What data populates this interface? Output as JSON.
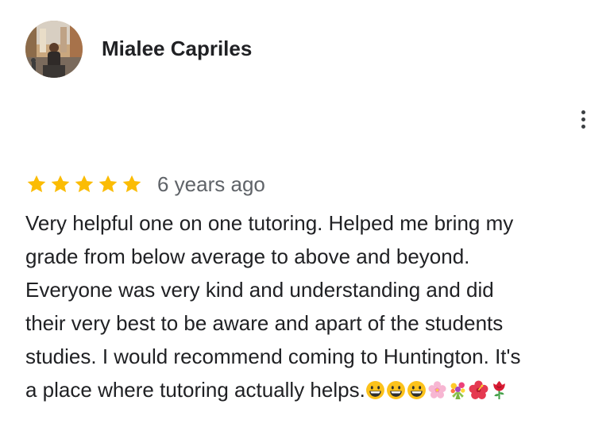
{
  "reviewer": {
    "name": "Mialee Capriles"
  },
  "review": {
    "rating": 5,
    "rating_max": 5,
    "star_color": "#fbbc04",
    "date": "6 years ago",
    "text_lines": [
      "Very helpful one on one tutoring. Helped me bring my",
      "grade from below average to above and beyond.",
      "Everyone was very kind and understanding and did",
      "their very best to be aware and apart of the students",
      "studies. I would recommend coming to Huntington.  It's",
      "a place where tutoring actually helps."
    ],
    "emojis": [
      "grinning-face-emoji",
      "grinning-face-emoji",
      "grinning-face-emoji",
      "cherry-blossom-emoji",
      "bouquet-emoji",
      "hibiscus-emoji",
      "rose-emoji"
    ]
  },
  "menu": {
    "icon": "more-vertical-icon"
  }
}
